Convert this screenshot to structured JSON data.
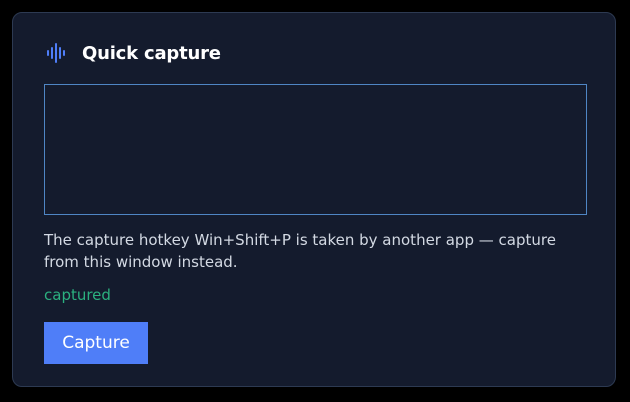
{
  "colors": {
    "page_background": "#000000",
    "card_background": "#141b2d",
    "accent": "#4f7ef8",
    "input_border": "#4f86c4",
    "status_success": "#2bb07f"
  },
  "header": {
    "icon": "audio-waveform-icon",
    "title": "Quick capture"
  },
  "capture_input": {
    "value": "",
    "placeholder": ""
  },
  "message": "The capture hotkey Win+Shift+P is taken by another app — capture from this window instead.",
  "status": "captured",
  "capture_button": {
    "label": "Capture"
  }
}
